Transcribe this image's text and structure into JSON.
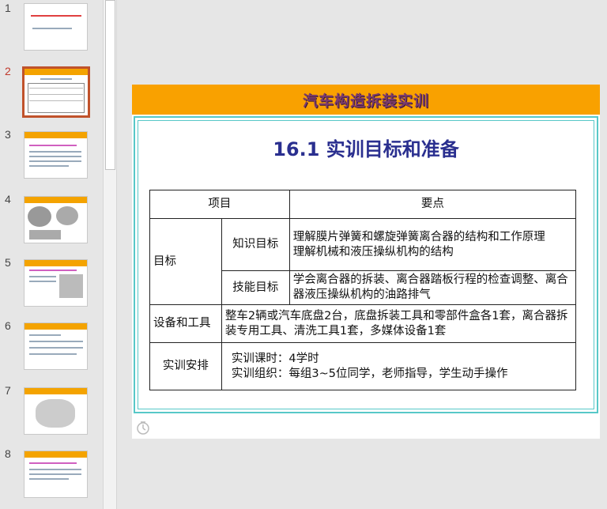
{
  "thumbnails": [
    {
      "number": "1"
    },
    {
      "number": "2"
    },
    {
      "number": "3"
    },
    {
      "number": "4"
    },
    {
      "number": "5"
    },
    {
      "number": "6"
    },
    {
      "number": "7"
    },
    {
      "number": "8"
    }
  ],
  "slide": {
    "header_title": "汽车构造拆装实训",
    "title": "16.1  实训目标和准备",
    "table": {
      "col_item": "项目",
      "col_points": "要点",
      "goal_label": "目标",
      "knowledge_label": "知识目标",
      "knowledge_text": "理解膜片弹簧和螺旋弹簧离合器的结构和工作原理\n理解机械和液压操纵机构的结构",
      "skill_label": "技能目标",
      "skill_text": "学会离合器的拆装、离合器踏板行程的检查调整、离合器液压操纵机构的油路排气",
      "equipment_label": "设备和工具",
      "equipment_text": "整车2辆或汽车底盘2台，底盘拆装工具和零部件盒各1套，离合器拆装专用工具、清洗工具1套，多媒体设备1套",
      "arrangement_label": "实训安排",
      "arrangement_text": "实训课时：4学时\n实训组织：每组3~5位同学，老师指导，学生动手操作"
    }
  },
  "colors": {
    "header_orange": "#f9a100",
    "frame_teal": "#58c8c8",
    "title_blue": "#2a2f8f",
    "active_thumb_border": "#c0522b"
  }
}
